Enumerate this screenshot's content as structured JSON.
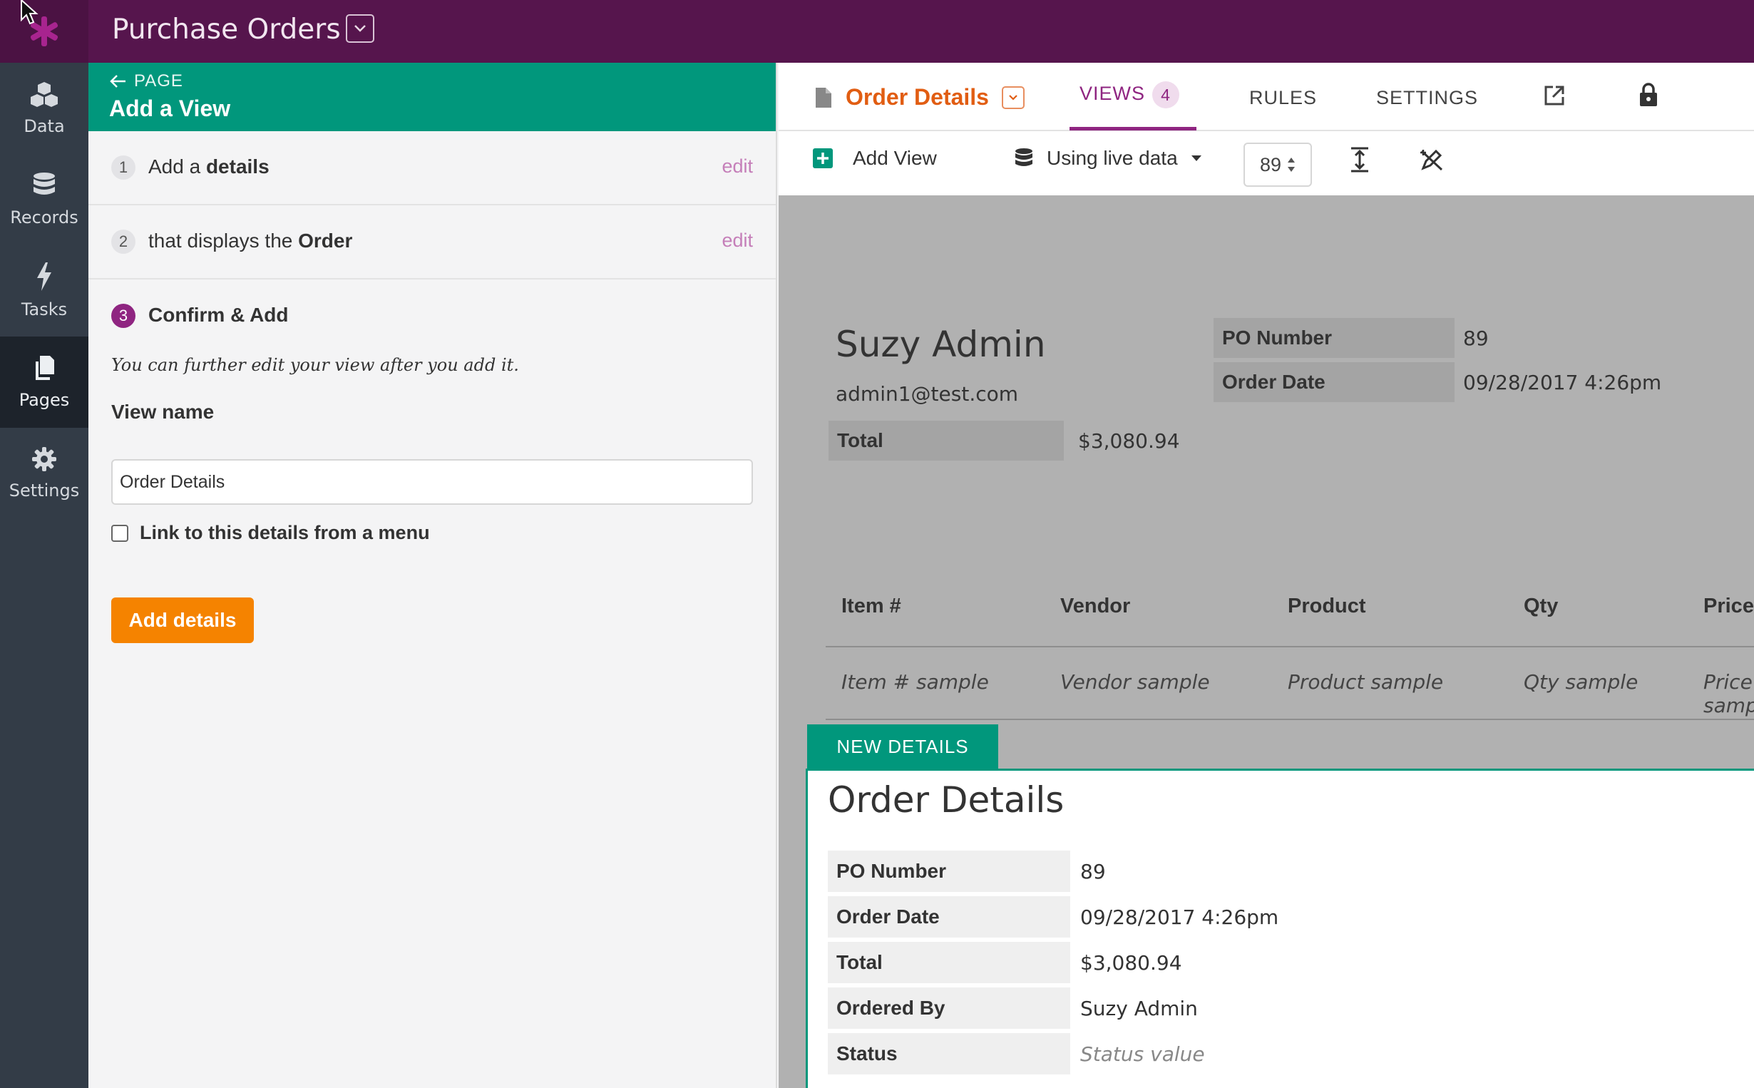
{
  "app": {
    "title": "Purchase Orders"
  },
  "nav": {
    "items": [
      {
        "label": "Data",
        "icon": "cubes-icon"
      },
      {
        "label": "Records",
        "icon": "database-icon"
      },
      {
        "label": "Tasks",
        "icon": "bolt-icon"
      },
      {
        "label": "Pages",
        "icon": "pages-icon",
        "active": true
      },
      {
        "label": "Settings",
        "icon": "gear-icon"
      }
    ]
  },
  "panel": {
    "back_label": "PAGE",
    "title": "Add a View",
    "steps": [
      {
        "num": "1",
        "prefix": "Add a ",
        "bold": "details",
        "edit": "edit"
      },
      {
        "num": "2",
        "prefix": "that displays the ",
        "bold": "Order",
        "edit": "edit"
      },
      {
        "num": "3",
        "bold": "Confirm & Add"
      }
    ],
    "hint": "You can further edit your view after you add it.",
    "view_name_label": "View name",
    "view_name_value": "Order Details",
    "link_menu_label": "Link to this details from a menu",
    "add_button": "Add details"
  },
  "viewer": {
    "view_name": "Order Details",
    "tabs": {
      "views": "VIEWS",
      "views_count": "4",
      "rules": "RULES",
      "settings": "SETTINGS"
    },
    "toolbar": {
      "add_view": "Add View",
      "data_mode": "Using live data",
      "record_id": "89"
    }
  },
  "canvas": {
    "customer_name": "Suzy Admin",
    "customer_email": "admin1@test.com",
    "total_label": "Total",
    "total_value": "$3,080.94",
    "po_label": "PO Number",
    "po_value": "89",
    "date_label": "Order Date",
    "date_value": "09/28/2017 4:26pm",
    "table": {
      "headers": [
        "Item #",
        "Vendor",
        "Product",
        "Qty",
        "Price"
      ],
      "sample": [
        "Item # sample",
        "Vendor sample",
        "Product sample",
        "Qty sample",
        "Price sample"
      ]
    },
    "new_tab_label": "NEW DETAILS",
    "new_view": {
      "title": "Order Details",
      "rows": [
        {
          "label": "PO Number",
          "value": "89"
        },
        {
          "label": "Order Date",
          "value": "09/28/2017 4:26pm"
        },
        {
          "label": "Total",
          "value": "$3,080.94"
        },
        {
          "label": "Ordered By",
          "value": "Suzy Admin"
        },
        {
          "label": "Status",
          "value": "Status value"
        }
      ]
    }
  },
  "colors": {
    "brand": "#56154d",
    "accent": "#01977c",
    "primary": "#f58300",
    "highlight": "#8f2581"
  }
}
